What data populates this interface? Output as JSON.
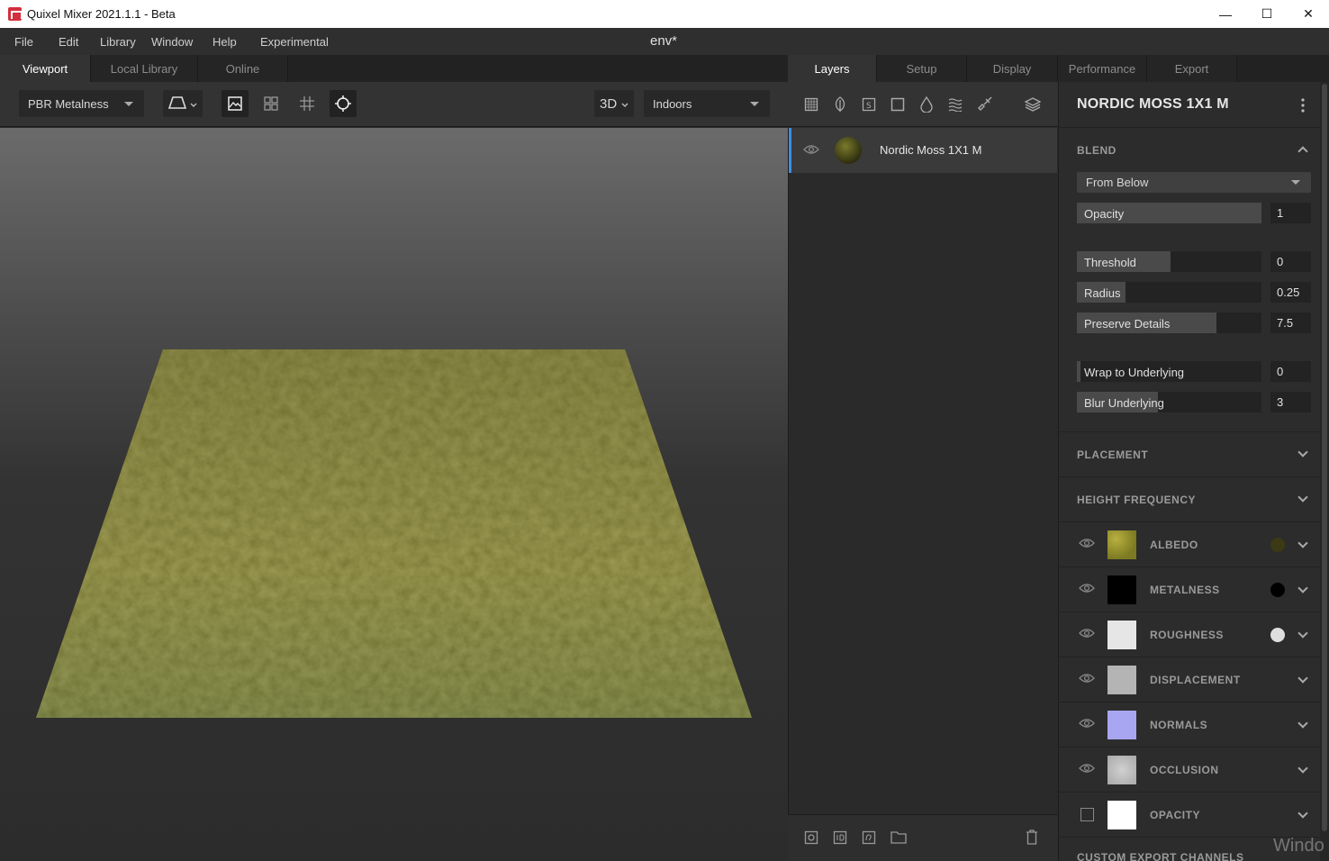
{
  "window": {
    "title": "Quixel Mixer 2021.1.1 - Beta",
    "minimize_glyph": "—",
    "maximize_glyph": "☐",
    "close_glyph": "✕"
  },
  "menu": {
    "items": [
      "File",
      "Edit",
      "Library",
      "Window",
      "Help",
      "Experimental"
    ],
    "document_title": "env*"
  },
  "left_tabs": [
    "Viewport",
    "Local Library",
    "Online"
  ],
  "viewport_toolbar": {
    "shading_mode": "PBR Metalness",
    "view_mode": "3D",
    "environment": "Indoors"
  },
  "mid_tabs": [
    "Layers",
    "Setup",
    "Display"
  ],
  "right_tabs": [
    "Performance",
    "Export"
  ],
  "layers": {
    "items": [
      {
        "name": "Nordic Moss 1X1 M"
      }
    ]
  },
  "properties": {
    "title": "NORDIC MOSS 1X1 M",
    "blend": {
      "header": "BLEND",
      "mode": "From Below",
      "opacity_label": "Opacity",
      "opacity_value": "1",
      "threshold_label": "Threshold",
      "threshold_value": "0",
      "radius_label": "Radius",
      "radius_value": "0.25",
      "preserve_label": "Preserve Details",
      "preserve_value": "7.5",
      "wrap_label": "Wrap to Underlying",
      "wrap_value": "0",
      "blur_label": "Blur Underlying",
      "blur_value": "3"
    },
    "placement_header": "PLACEMENT",
    "height_frequency_header": "HEIGHT FREQUENCY",
    "maps": [
      {
        "name": "ALBEDO",
        "swatch": "#3c3a14"
      },
      {
        "name": "METALNESS",
        "swatch": "#000000"
      },
      {
        "name": "ROUGHNESS",
        "swatch": "#dedede"
      },
      {
        "name": "DISPLACEMENT"
      },
      {
        "name": "NORMALS"
      },
      {
        "name": "OCCLUSION"
      },
      {
        "name": "OPACITY"
      }
    ],
    "custom_export_header": "CUSTOM EXPORT CHANNELS"
  },
  "watermark": "Windo",
  "colors": {
    "accent": "#3d8ee0",
    "panel": "#2c2c2c",
    "moss": "#6b6a24"
  }
}
